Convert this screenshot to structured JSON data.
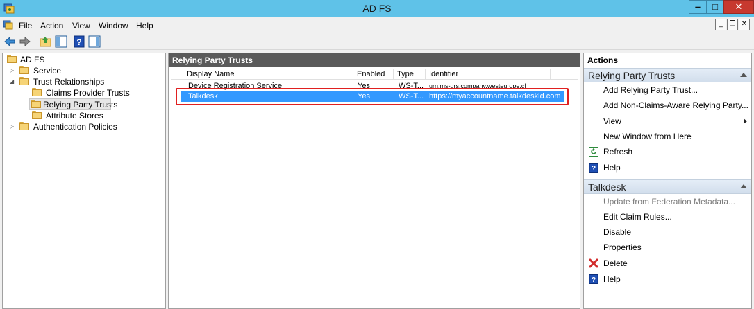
{
  "window": {
    "title": "AD FS",
    "min_glyph": "‒",
    "max_glyph": "□",
    "close_glyph": "✕"
  },
  "menu": {
    "file": "File",
    "action": "Action",
    "view": "View",
    "window": "Window",
    "help": "Help"
  },
  "tree": {
    "root": "AD FS",
    "service": "Service",
    "trust_relationships": "Trust Relationships",
    "claims_provider_trusts": "Claims Provider Trusts",
    "relying_party_trusts": "Relying Party Trusts",
    "attribute_stores": "Attribute Stores",
    "authentication_policies": "Authentication Policies"
  },
  "center": {
    "header": "Relying Party Trusts",
    "columns": [
      "Display Name",
      "Enabled",
      "Type",
      "Identifier"
    ],
    "rows": [
      {
        "name": "Device Registration Service",
        "enabled": "Yes",
        "type": "WS-T...",
        "identifier": "urn:ms-drs:company.westeurope.cl"
      },
      {
        "name": "Talkdesk",
        "enabled": "Yes",
        "type": "WS-T...",
        "identifier": "https://myaccountname.talkdeskid.com"
      }
    ]
  },
  "actions": {
    "title": "Actions",
    "section1": {
      "title": "Relying Party Trusts",
      "items": [
        "Add Relying Party Trust...",
        "Add Non-Claims-Aware Relying Party...",
        "View",
        "New Window from Here",
        "Refresh",
        "Help"
      ]
    },
    "section2": {
      "title": "Talkdesk",
      "items": [
        "Update from Federation Metadata...",
        "Edit Claim Rules...",
        "Disable",
        "Properties",
        "Delete",
        "Help"
      ]
    }
  },
  "colors": {
    "titlebar": "#5fc2e8",
    "selection": "#3399ff",
    "highlight": "#e02020",
    "close": "#c7392f"
  }
}
